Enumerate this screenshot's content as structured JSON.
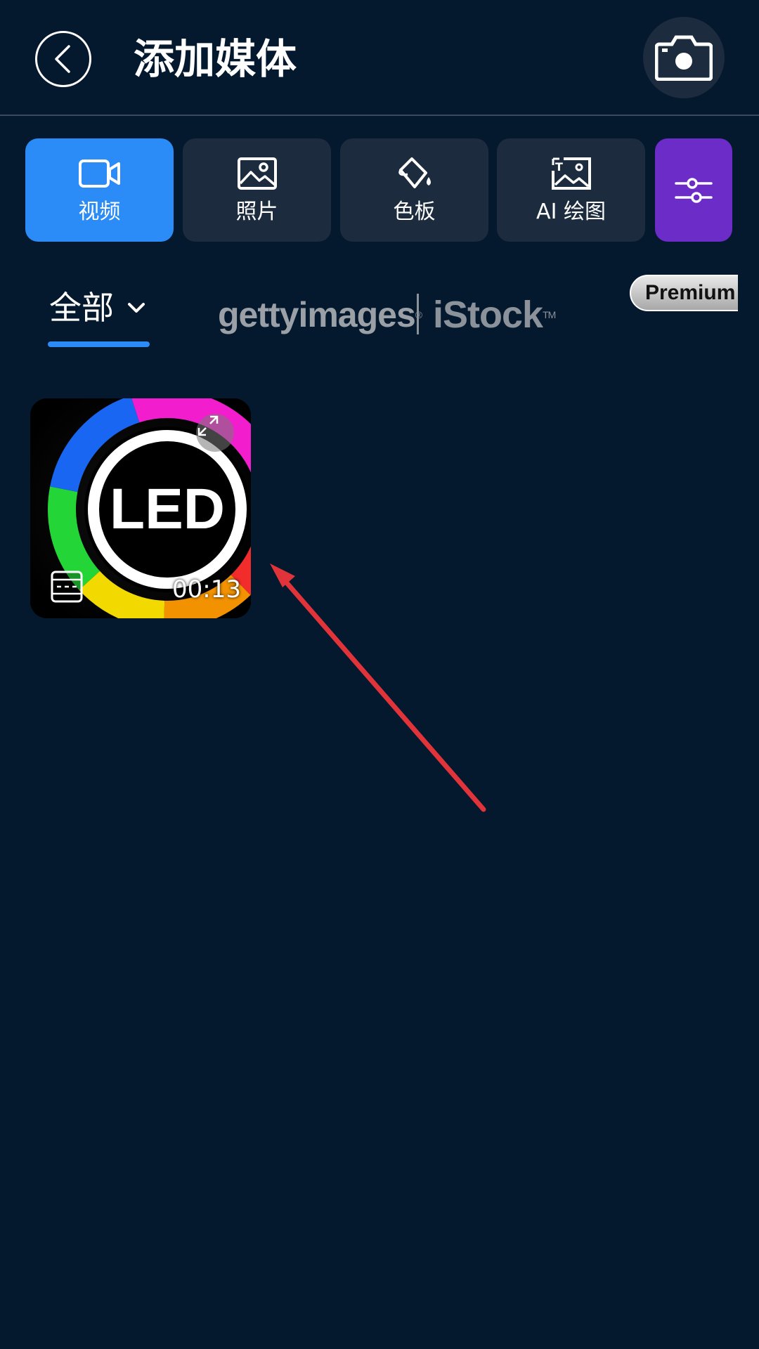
{
  "header": {
    "title": "添加媒体"
  },
  "tabs": [
    {
      "label": "视频",
      "icon": "video-camera-icon",
      "active": true
    },
    {
      "label": "照片",
      "icon": "photo-icon",
      "active": false
    },
    {
      "label": "色板",
      "icon": "paint-bucket-icon",
      "active": false
    },
    {
      "label": "AI 绘图",
      "icon": "ai-image-icon",
      "active": false
    }
  ],
  "filter_button_icon": "sliders-icon",
  "category": {
    "label": "全部"
  },
  "stock_logos": {
    "getty": "gettyimages",
    "getty_mark": "®",
    "istock": "iStock",
    "istock_mark": "TM",
    "premium": "Premium"
  },
  "media": [
    {
      "type": "video",
      "duration": "00:13",
      "thumbnail_text": "LED"
    }
  ],
  "colors": {
    "background": "#04182e",
    "tab_bg": "#1c2c3e",
    "accent": "#2b8cf7",
    "filter": "#6b2cc8",
    "annotation_arrow": "#e0343a"
  }
}
